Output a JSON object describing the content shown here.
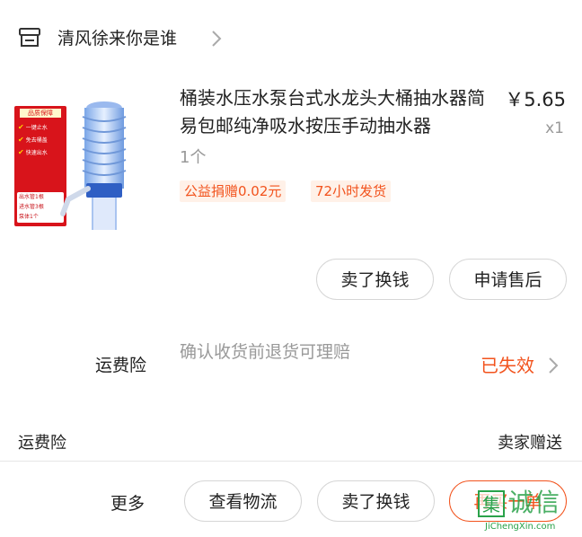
{
  "store": {
    "name": "清风徐来你是谁",
    "icon": "store-icon"
  },
  "product": {
    "title": "桶装水压水泵台式水龙头大桶抽水器简易包邮纯净吸水按压手动抽水器",
    "price": "￥5.65",
    "quantity": "x1",
    "spec": "1个",
    "tags": [
      "公益捐赠0.02元",
      "72小时发货"
    ],
    "image": {
      "sticker_title": "品质保障",
      "sticker_lines": [
        "一键止水",
        "免去桶盖",
        "快速出水"
      ],
      "sticker_box": [
        "出水管1根",
        "进水管3根",
        "泵体1个"
      ]
    }
  },
  "actions": {
    "sell": "卖了换钱",
    "after_sale": "申请售后"
  },
  "insurance": {
    "label": "运费险",
    "description": "确认收货前退货可理赔",
    "status": "已失效"
  },
  "fee": {
    "label": "运费险",
    "value": "卖家赠送"
  },
  "bottom_bar": {
    "more": "更多",
    "logistics": "查看物流",
    "sell": "卖了换钱",
    "buy_again": "再买一单"
  },
  "watermark": {
    "badge": "集",
    "text": "诚信",
    "url": "JiChengXin.com"
  },
  "colors": {
    "accent": "#f2531d",
    "muted": "#999999",
    "tag_bg": "#fff1e8",
    "watermark": "#2aa24a"
  }
}
